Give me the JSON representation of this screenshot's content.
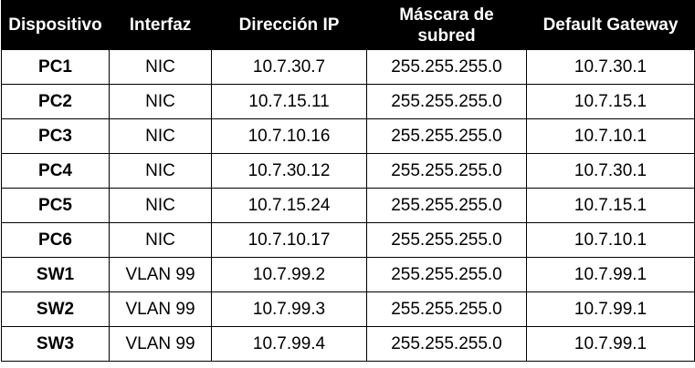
{
  "table": {
    "headers": [
      "Dispositivo",
      "Interfaz",
      "Dirección IP",
      "Máscara de subred",
      "Default Gateway"
    ],
    "rows": [
      [
        "PC1",
        "NIC",
        "10.7.30.7",
        "255.255.255.0",
        "10.7.30.1"
      ],
      [
        "PC2",
        "NIC",
        "10.7.15.11",
        "255.255.255.0",
        "10.7.15.1"
      ],
      [
        "PC3",
        "NIC",
        "10.7.10.16",
        "255.255.255.0",
        "10.7.10.1"
      ],
      [
        "PC4",
        "NIC",
        "10.7.30.12",
        "255.255.255.0",
        "10.7.30.1"
      ],
      [
        "PC5",
        "NIC",
        "10.7.15.24",
        "255.255.255.0",
        "10.7.15.1"
      ],
      [
        "PC6",
        "NIC",
        "10.7.10.17",
        "255.255.255.0",
        "10.7.10.1"
      ],
      [
        "SW1",
        "VLAN 99",
        "10.7.99.2",
        "255.255.255.0",
        "10.7.99.1"
      ],
      [
        "SW2",
        "VLAN 99",
        "10.7.99.3",
        "255.255.255.0",
        "10.7.99.1"
      ],
      [
        "SW3",
        "VLAN 99",
        "10.7.99.4",
        "255.255.255.0",
        "10.7.99.1"
      ]
    ]
  },
  "colors": {
    "header_bg": "#000000",
    "header_text": "#ffffff",
    "border": "#000000"
  }
}
